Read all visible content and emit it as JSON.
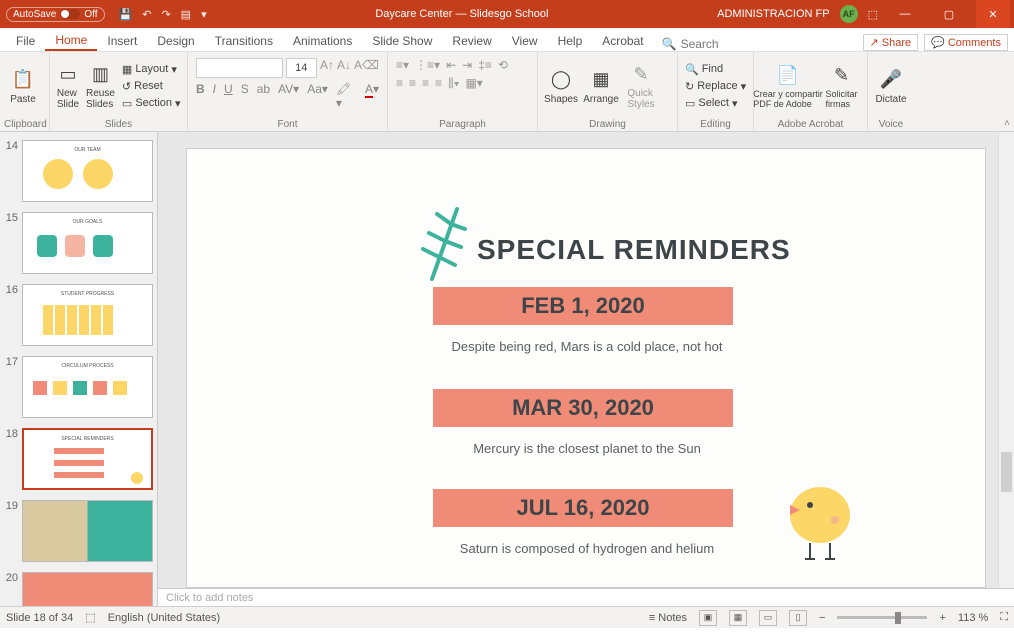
{
  "titlebar": {
    "autosave": "AutoSave",
    "autosave_state": "Off",
    "doc_title": "Daycare Center — Slidesgo School",
    "user": "ADMINISTRACION FP",
    "avatar": "AF"
  },
  "menu": {
    "tabs": [
      "File",
      "Home",
      "Insert",
      "Design",
      "Transitions",
      "Animations",
      "Slide Show",
      "Review",
      "View",
      "Help",
      "Acrobat"
    ],
    "active": "Home",
    "search": "Search",
    "share": "Share",
    "comments": "Comments"
  },
  "ribbon": {
    "clipboard": {
      "label": "Clipboard",
      "paste": "Paste"
    },
    "slides": {
      "label": "Slides",
      "new": "New\nSlide",
      "reuse": "Reuse\nSlides",
      "layout": "Layout",
      "reset": "Reset",
      "section": "Section"
    },
    "font": {
      "label": "Font",
      "size": "14"
    },
    "paragraph": {
      "label": "Paragraph"
    },
    "drawing": {
      "label": "Drawing",
      "shapes": "Shapes",
      "arrange": "Arrange",
      "quick": "Quick\nStyles"
    },
    "editing": {
      "label": "Editing",
      "find": "Find",
      "replace": "Replace",
      "select": "Select"
    },
    "adobe": {
      "label": "Adobe Acrobat",
      "create": "Crear y compartir\nPDF de Adobe",
      "sign": "Solicitar\nfirmas"
    },
    "voice": {
      "label": "Voice",
      "dictate": "Dictate"
    }
  },
  "thumbs": {
    "visible": [
      14,
      15,
      16,
      17,
      18,
      19,
      20
    ],
    "selected": 18
  },
  "slide": {
    "title": "SPECIAL REMINDERS",
    "items": [
      {
        "date": "FEB 1, 2020",
        "caption": "Despite being red, Mars is a cold place, not hot"
      },
      {
        "date": "MAR 30, 2020",
        "caption": "Mercury is the closest planet to the Sun"
      },
      {
        "date": "JUL 16, 2020",
        "caption": "Saturn is composed of hydrogen and helium"
      }
    ]
  },
  "notes": {
    "placeholder": "Click to add notes"
  },
  "status": {
    "slide_count": "Slide 18 of 34",
    "lang": "English (United States)",
    "notes": "Notes",
    "zoom": "113 %"
  }
}
